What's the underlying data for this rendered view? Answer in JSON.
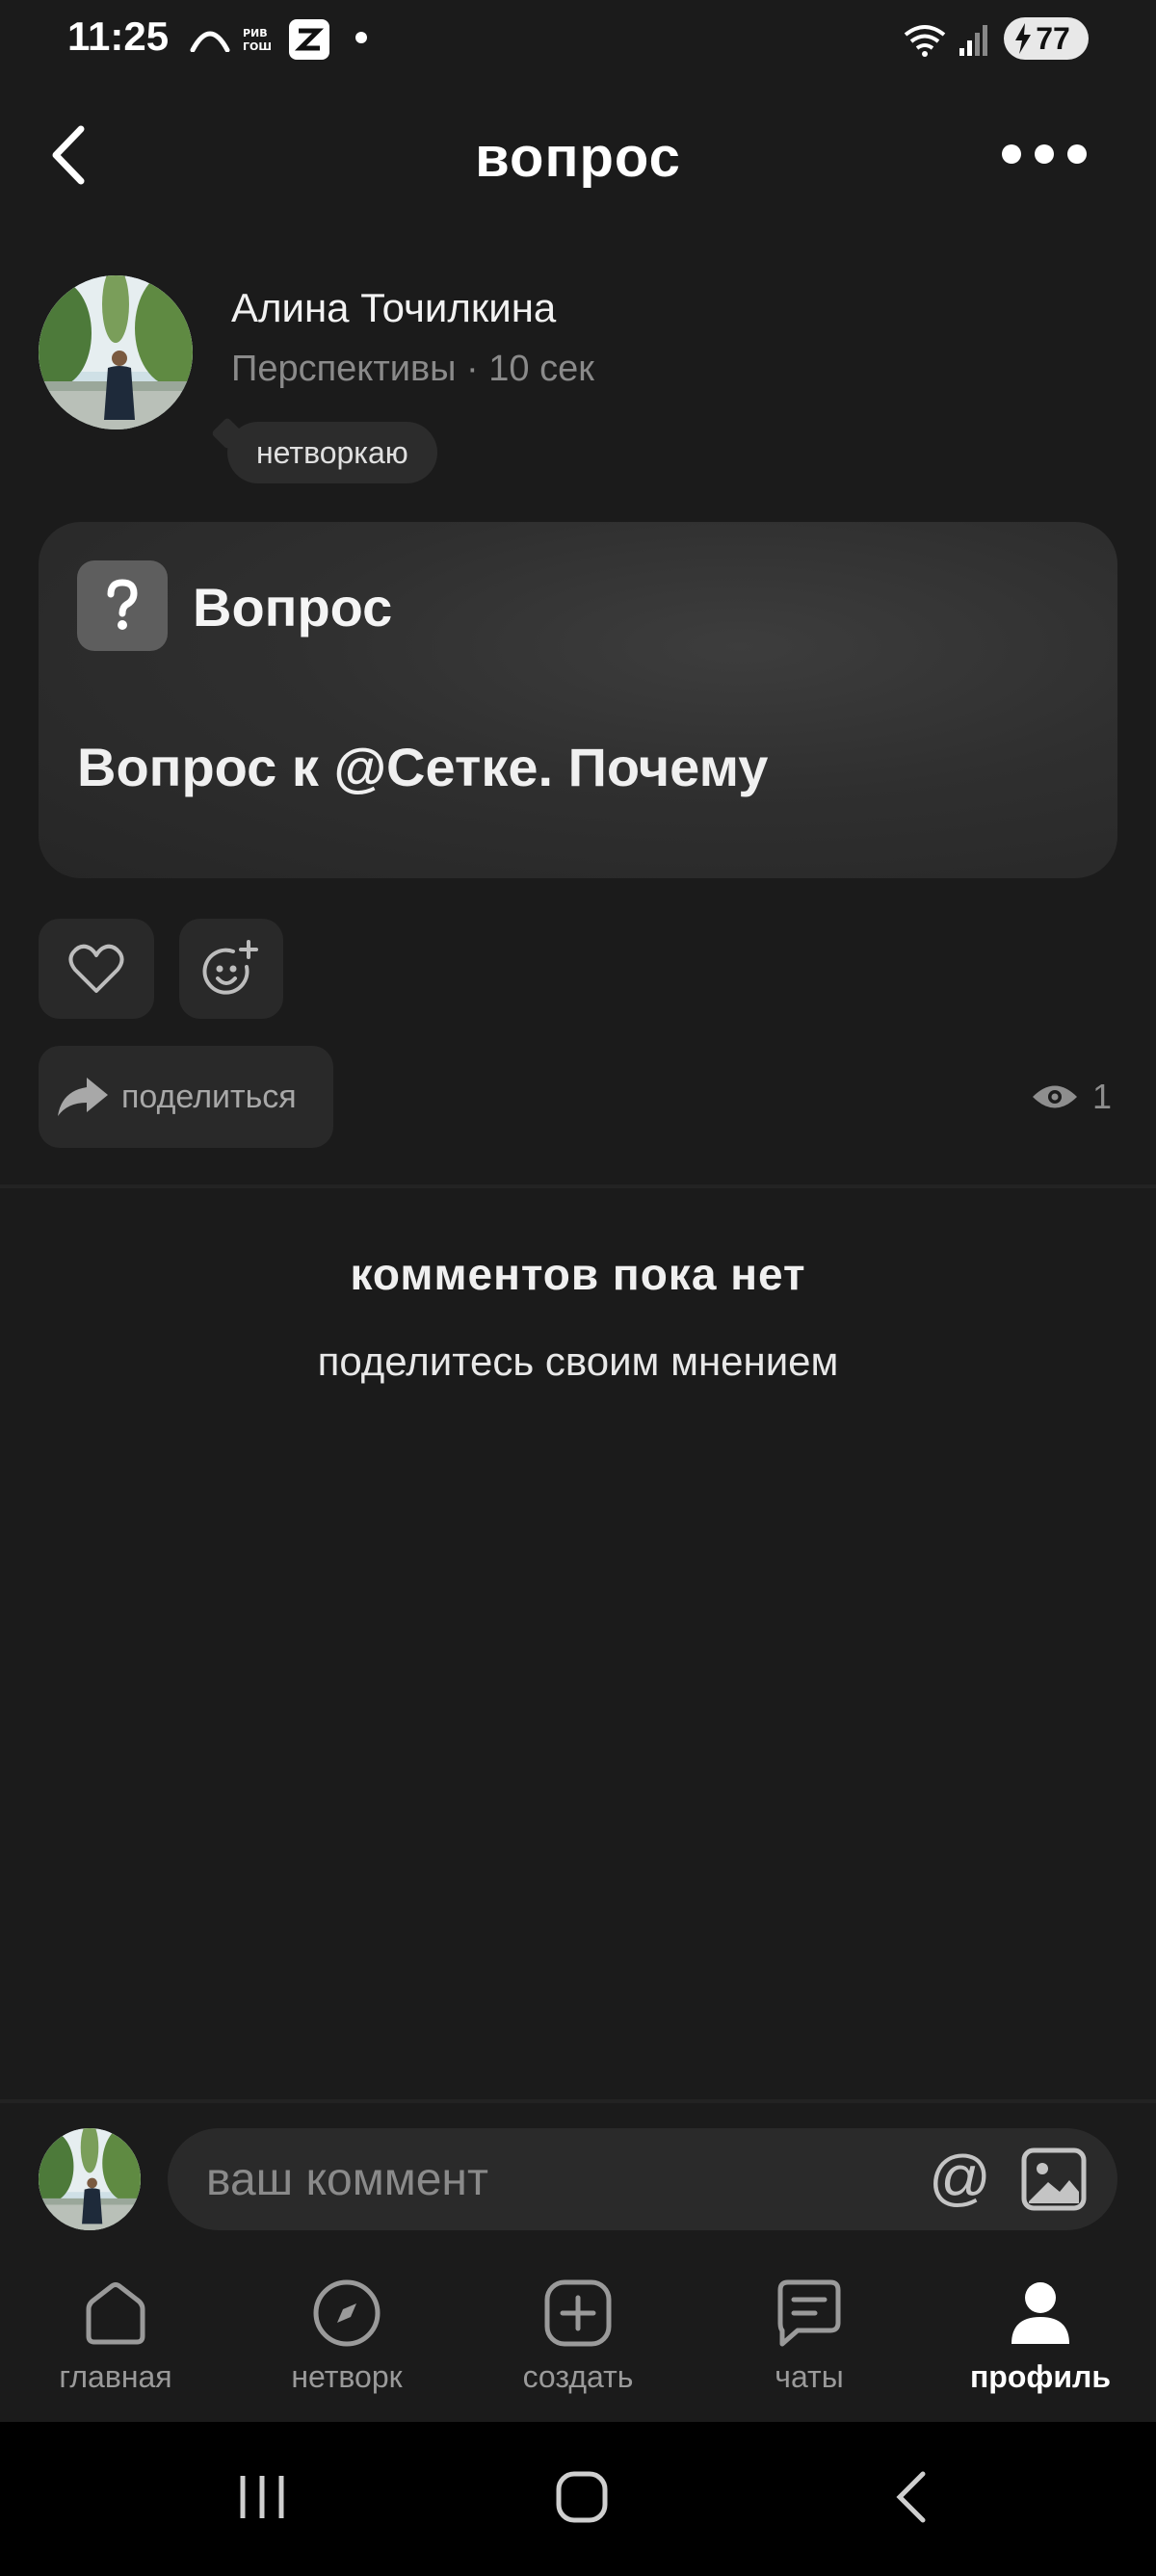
{
  "status_bar": {
    "time": "11:25",
    "carrier_badge": "РИВ\nГОШ",
    "battery": "77"
  },
  "header": {
    "title": "вопрос"
  },
  "post": {
    "author_name": "Алина Точилкина",
    "author_meta": "Перспективы · 10 сек",
    "tag": "нетворкаю",
    "card_label": "Вопрос",
    "card_text": "Вопрос к @Сетке. Почему",
    "share_label": "поделиться",
    "views_count": "1"
  },
  "comments": {
    "empty_title": "комментов пока нет",
    "empty_subtitle": "поделитесь своим мнением",
    "input_placeholder": "ваш коммент",
    "at_symbol": "@"
  },
  "nav": {
    "items": [
      {
        "label": "главная",
        "icon": "home-icon"
      },
      {
        "label": "нетворк",
        "icon": "compass-icon"
      },
      {
        "label": "создать",
        "icon": "plus-square-icon"
      },
      {
        "label": "чаты",
        "icon": "chat-icon"
      },
      {
        "label": "профиль",
        "icon": "profile-icon",
        "active": true
      }
    ]
  },
  "colors": {
    "background": "#1b1b1b",
    "card": "#2f2f2f",
    "button": "#292929",
    "muted_text": "#8a8a8a"
  }
}
